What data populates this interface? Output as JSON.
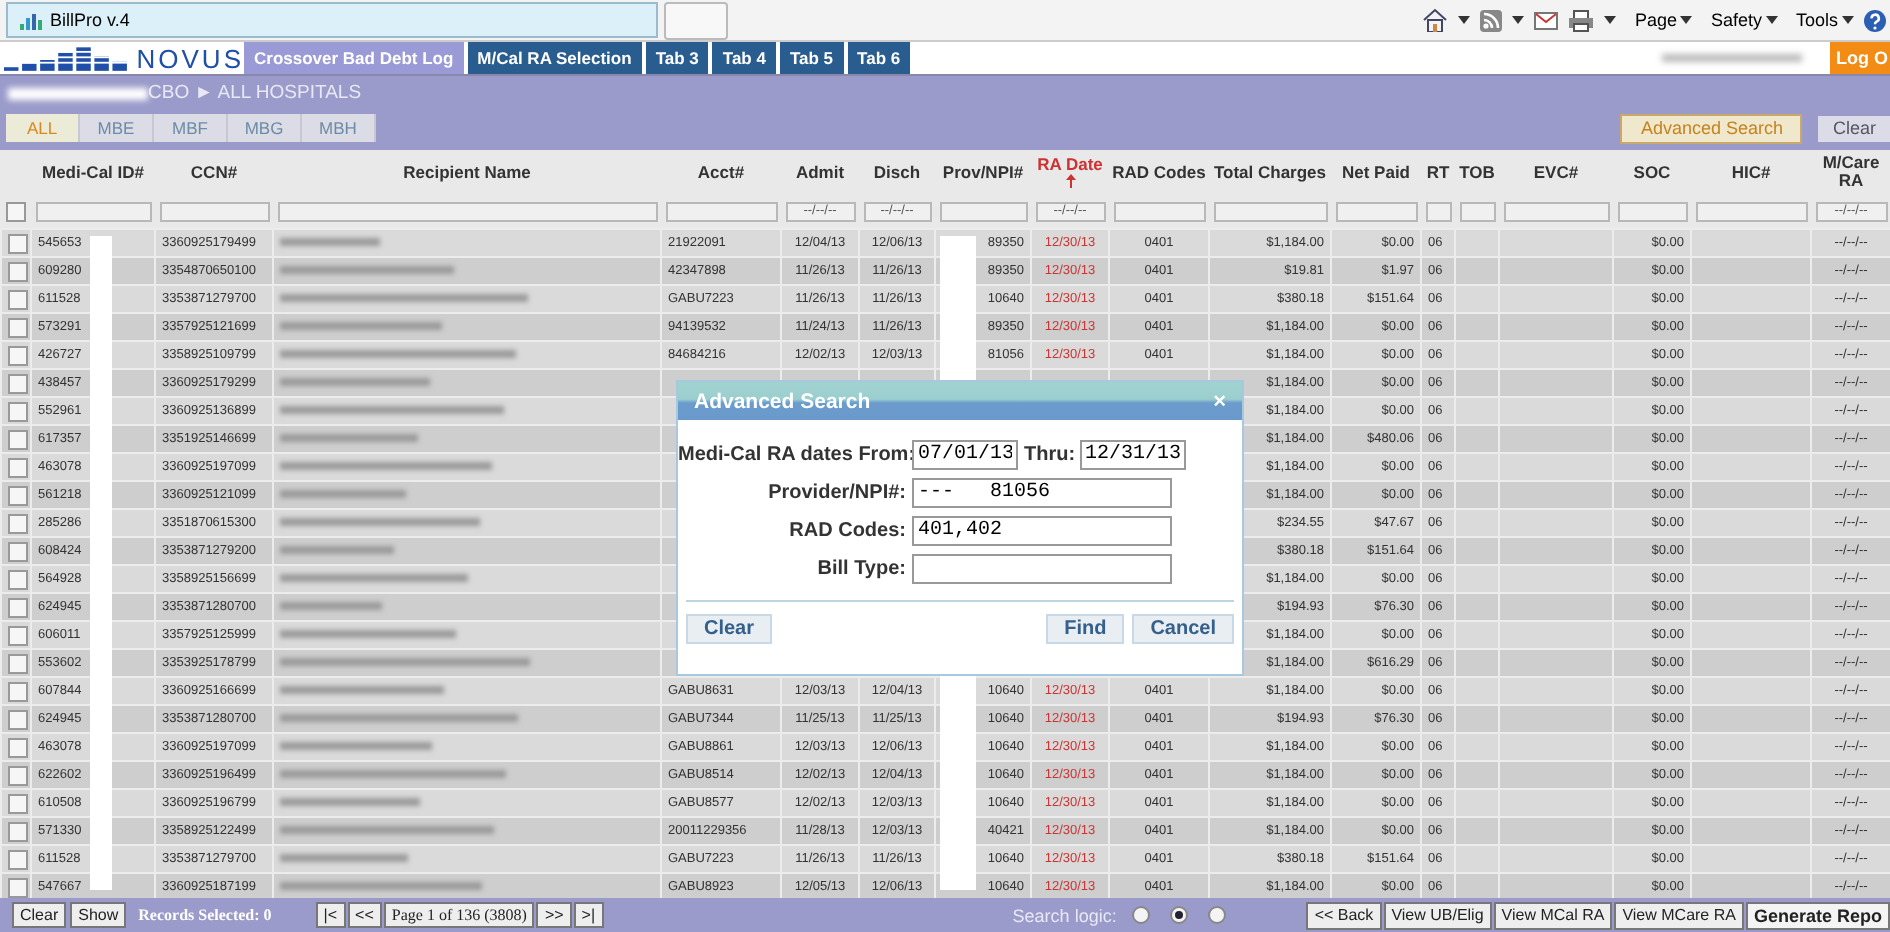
{
  "browser": {
    "tab_title": "BillPro v.4",
    "menus": [
      "Page",
      "Safety",
      "Tools"
    ]
  },
  "app": {
    "logo": "NOVUS",
    "tabs": [
      {
        "label": "Crossover Bad Debt Log",
        "selected": true
      },
      {
        "label": "M/Cal RA Selection",
        "selected": false
      },
      {
        "label": "Tab 3",
        "selected": false
      },
      {
        "label": "Tab 4",
        "selected": false
      },
      {
        "label": "Tab 5",
        "selected": false
      },
      {
        "label": "Tab 6",
        "selected": false
      }
    ],
    "logout": "Log O"
  },
  "breadcrumb": "CBO ► ALL HOSPITALS",
  "filter_tabs": [
    {
      "label": "ALL",
      "selected": true
    },
    {
      "label": "MBE",
      "selected": false
    },
    {
      "label": "MBF",
      "selected": false
    },
    {
      "label": "MBG",
      "selected": false
    },
    {
      "label": "MBH",
      "selected": false
    }
  ],
  "actions": [
    {
      "label": "Advanced Search",
      "kind": "highlight"
    },
    {
      "label": "Clear",
      "kind": "plain"
    }
  ],
  "table": {
    "select_all": {
      "checked": false
    },
    "columns": [
      {
        "label": "Medi-Cal ID#",
        "kind": "text",
        "sorted": false
      },
      {
        "label": "CCN#",
        "kind": "text",
        "sorted": false
      },
      {
        "label": "Recipient Name",
        "kind": "redacted",
        "sorted": false
      },
      {
        "label": "Acct#",
        "kind": "text",
        "sorted": false
      },
      {
        "label": "Admit",
        "kind": "text",
        "sorted": false,
        "placeholder": "--/--/--"
      },
      {
        "label": "Disch",
        "kind": "text",
        "sorted": false,
        "placeholder": "--/--/--"
      },
      {
        "label": "Prov/NPI#",
        "kind": "text",
        "sorted": false
      },
      {
        "label": "RA Date",
        "kind": "text",
        "sorted": true,
        "placeholder": "--/--/--"
      },
      {
        "label": "RAD Codes",
        "kind": "text",
        "sorted": false
      },
      {
        "label": "Total Charges",
        "kind": "text",
        "sorted": false
      },
      {
        "label": "Net Paid",
        "kind": "text",
        "sorted": false
      },
      {
        "label": "RT",
        "kind": "text",
        "sorted": false
      },
      {
        "label": "TOB",
        "kind": "text",
        "sorted": false
      },
      {
        "label": "EVC#",
        "kind": "text",
        "sorted": false
      },
      {
        "label": "SOC",
        "kind": "text",
        "sorted": false
      },
      {
        "label": "HIC#",
        "kind": "text",
        "sorted": false
      },
      {
        "label": "M/Care RA",
        "kind": "text",
        "sorted": false,
        "placeholder": "--/--/--"
      }
    ],
    "rows": [
      {
        "checked": false,
        "cells": [
          "545653",
          "3360925179499",
          null,
          "21922091",
          "12/04/13",
          "12/06/13",
          "89350",
          "12/30/13",
          "0401",
          "$1,184.00",
          "$0.00",
          "06",
          null,
          null,
          "$0.00",
          null,
          "--/--/--"
        ]
      },
      {
        "checked": false,
        "cells": [
          "609280",
          "3354870650100",
          null,
          "42347898",
          "11/26/13",
          "11/26/13",
          "89350",
          "12/30/13",
          "0401",
          "$19.81",
          "$1.97",
          "06",
          null,
          null,
          "$0.00",
          null,
          "--/--/--"
        ]
      },
      {
        "checked": false,
        "cells": [
          "611528",
          "3353871279700",
          null,
          "GABU7223",
          "11/26/13",
          "11/26/13",
          "10640",
          "12/30/13",
          "0401",
          "$380.18",
          "$151.64",
          "06",
          null,
          null,
          "$0.00",
          null,
          "--/--/--"
        ]
      },
      {
        "checked": false,
        "cells": [
          "573291",
          "3357925121699",
          null,
          "94139532",
          "11/24/13",
          "11/26/13",
          "89350",
          "12/30/13",
          "0401",
          "$1,184.00",
          "$0.00",
          "06",
          null,
          null,
          "$0.00",
          null,
          "--/--/--"
        ]
      },
      {
        "checked": false,
        "cells": [
          "426727",
          "3358925109799",
          null,
          "84684216",
          "12/02/13",
          "12/03/13",
          "81056",
          "12/30/13",
          "0401",
          "$1,184.00",
          "$0.00",
          "06",
          null,
          null,
          "$0.00",
          null,
          "--/--/--"
        ]
      },
      {
        "checked": false,
        "cells": [
          "438457",
          "3360925179299",
          null,
          null,
          null,
          null,
          null,
          null,
          null,
          "$1,184.00",
          "$0.00",
          "06",
          null,
          null,
          "$0.00",
          null,
          "--/--/--"
        ]
      },
      {
        "checked": false,
        "cells": [
          "552961",
          "3360925136899",
          null,
          null,
          null,
          null,
          null,
          null,
          null,
          "$1,184.00",
          "$0.00",
          "06",
          null,
          null,
          "$0.00",
          null,
          "--/--/--"
        ]
      },
      {
        "checked": false,
        "cells": [
          "617357",
          "3351925146699",
          null,
          null,
          null,
          null,
          null,
          null,
          null,
          "$1,184.00",
          "$480.06",
          "06",
          null,
          null,
          "$0.00",
          null,
          "--/--/--"
        ]
      },
      {
        "checked": false,
        "cells": [
          "463078",
          "3360925197099",
          null,
          null,
          null,
          null,
          null,
          null,
          null,
          "$1,184.00",
          "$0.00",
          "06",
          null,
          null,
          "$0.00",
          null,
          "--/--/--"
        ]
      },
      {
        "checked": false,
        "cells": [
          "561218",
          "3360925121099",
          null,
          null,
          null,
          null,
          null,
          null,
          null,
          "$1,184.00",
          "$0.00",
          "06",
          null,
          null,
          "$0.00",
          null,
          "--/--/--"
        ]
      },
      {
        "checked": false,
        "cells": [
          "285286",
          "3351870615300",
          null,
          null,
          null,
          null,
          null,
          null,
          null,
          "$234.55",
          "$47.67",
          "06",
          null,
          null,
          "$0.00",
          null,
          "--/--/--"
        ]
      },
      {
        "checked": false,
        "cells": [
          "608424",
          "3353871279200",
          null,
          null,
          null,
          null,
          null,
          null,
          null,
          "$380.18",
          "$151.64",
          "06",
          null,
          null,
          "$0.00",
          null,
          "--/--/--"
        ]
      },
      {
        "checked": false,
        "cells": [
          "564928",
          "3358925156699",
          null,
          null,
          null,
          null,
          null,
          null,
          null,
          "$1,184.00",
          "$0.00",
          "06",
          null,
          null,
          "$0.00",
          null,
          "--/--/--"
        ]
      },
      {
        "checked": false,
        "cells": [
          "624945",
          "3353871280700",
          null,
          null,
          null,
          null,
          null,
          null,
          null,
          "$194.93",
          "$76.30",
          "06",
          null,
          null,
          "$0.00",
          null,
          "--/--/--"
        ]
      },
      {
        "checked": false,
        "cells": [
          "606011",
          "3357925125999",
          null,
          null,
          null,
          null,
          null,
          null,
          null,
          "$1,184.00",
          "$0.00",
          "06",
          null,
          null,
          "$0.00",
          null,
          "--/--/--"
        ]
      },
      {
        "checked": false,
        "cells": [
          "553602",
          "3353925178799",
          null,
          null,
          null,
          null,
          null,
          null,
          null,
          "$1,184.00",
          "$616.29",
          "06",
          null,
          null,
          "$0.00",
          null,
          "--/--/--"
        ]
      },
      {
        "checked": false,
        "cells": [
          "607844",
          "3360925166699",
          null,
          "GABU8631",
          "12/03/13",
          "12/04/13",
          "10640",
          "12/30/13",
          "0401",
          "$1,184.00",
          "$0.00",
          "06",
          null,
          null,
          "$0.00",
          null,
          "--/--/--"
        ]
      },
      {
        "checked": false,
        "cells": [
          "624945",
          "3353871280700",
          null,
          "GABU7344",
          "11/25/13",
          "11/25/13",
          "10640",
          "12/30/13",
          "0401",
          "$194.93",
          "$76.30",
          "06",
          null,
          null,
          "$0.00",
          null,
          "--/--/--"
        ]
      },
      {
        "checked": false,
        "cells": [
          "463078",
          "3360925197099",
          null,
          "GABU8861",
          "12/03/13",
          "12/06/13",
          "10640",
          "12/30/13",
          "0401",
          "$1,184.00",
          "$0.00",
          "06",
          null,
          null,
          "$0.00",
          null,
          "--/--/--"
        ]
      },
      {
        "checked": false,
        "cells": [
          "622602",
          "3360925196499",
          null,
          "GABU8514",
          "12/02/13",
          "12/04/13",
          "10640",
          "12/30/13",
          "0401",
          "$1,184.00",
          "$0.00",
          "06",
          null,
          null,
          "$0.00",
          null,
          "--/--/--"
        ]
      },
      {
        "checked": false,
        "cells": [
          "610508",
          "3360925196799",
          null,
          "GABU8577",
          "12/02/13",
          "12/03/13",
          "10640",
          "12/30/13",
          "0401",
          "$1,184.00",
          "$0.00",
          "06",
          null,
          null,
          "$0.00",
          null,
          "--/--/--"
        ]
      },
      {
        "checked": false,
        "cells": [
          "571330",
          "3358925122499",
          null,
          "20011229356",
          "11/28/13",
          "12/03/13",
          "40421",
          "12/30/13",
          "0401",
          "$1,184.00",
          "$0.00",
          "06",
          null,
          null,
          "$0.00",
          null,
          "--/--/--"
        ]
      },
      {
        "checked": false,
        "cells": [
          "611528",
          "3353871279700",
          null,
          "GABU7223",
          "11/26/13",
          "11/26/13",
          "10640",
          "12/30/13",
          "0401",
          "$380.18",
          "$151.64",
          "06",
          null,
          null,
          "$0.00",
          null,
          "--/--/--"
        ]
      },
      {
        "checked": false,
        "cells": [
          "547667",
          "3360925187199",
          null,
          "GABU8923",
          "12/05/13",
          "12/06/13",
          "10640",
          "12/30/13",
          "0401",
          "$1,184.00",
          "$0.00",
          "06",
          null,
          null,
          "$0.00",
          null,
          "--/--/--"
        ]
      }
    ]
  },
  "dialog": {
    "title": "Advanced Search",
    "close": "×",
    "fields": [
      {
        "label": "Medi-Cal RA dates From:",
        "value": "07/01/13",
        "thru_label": "Thru:",
        "thru_value": "12/31/13"
      },
      {
        "label": "Provider/NPI#:",
        "value": "---   81056"
      },
      {
        "label": "RAD Codes:",
        "value": "401,402"
      },
      {
        "label": "Bill Type:"
      }
    ],
    "buttons": [
      {
        "label": "Clear",
        "kind": "left"
      },
      {
        "label": "Find",
        "kind": "right"
      },
      {
        "label": "Cancel",
        "kind": "right"
      }
    ]
  },
  "status_bar": {
    "buttons": [
      "Clear",
      "Show"
    ],
    "records_selected": "Records Selected: 0",
    "pager": [
      "|<",
      "<<",
      "Page 1 of 136 (3808)",
      ">>",
      ">|"
    ],
    "search_logic": {
      "label": "Search logic:",
      "options": [
        {
          "selected": false
        },
        {
          "selected": true
        },
        {
          "selected": false
        }
      ]
    },
    "actions": [
      {
        "label": "<< Back",
        "kind": "normal"
      },
      {
        "label": "View UB/Elig",
        "kind": "normal"
      },
      {
        "label": "View MCal RA",
        "kind": "normal"
      },
      {
        "label": "View MCare RA",
        "kind": "normal"
      },
      {
        "label": "Generate Repo",
        "kind": "primary"
      }
    ]
  }
}
